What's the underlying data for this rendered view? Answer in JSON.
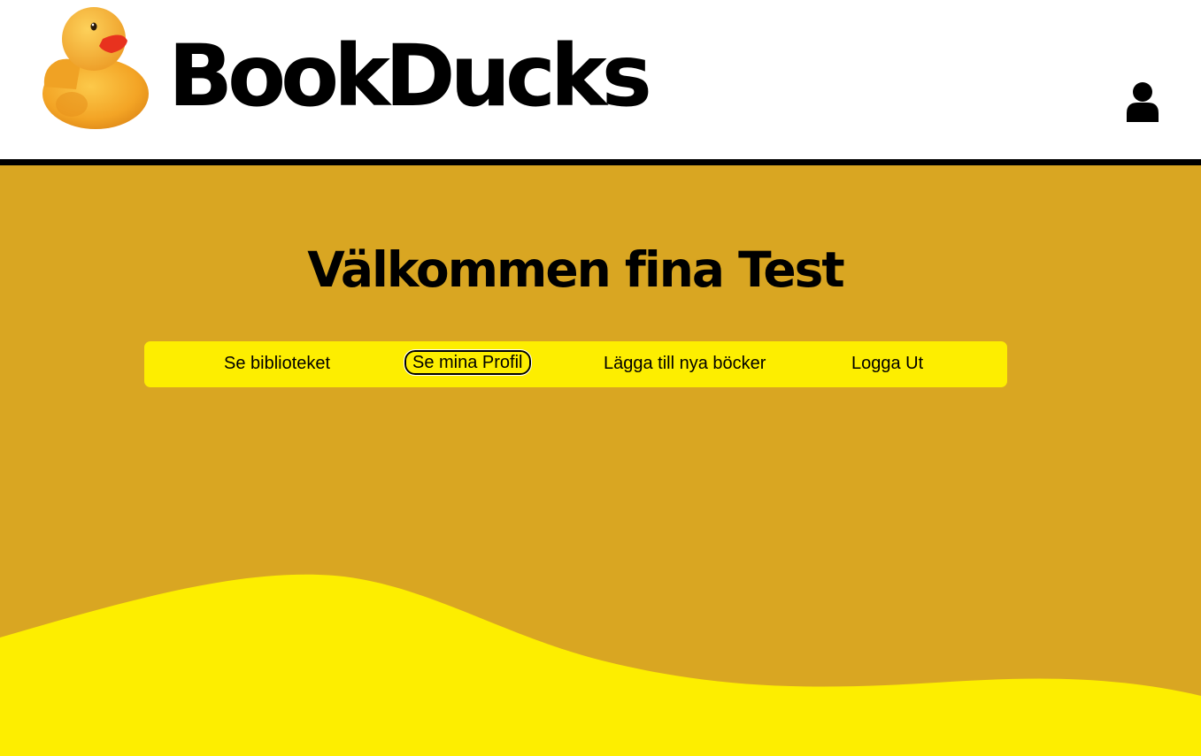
{
  "header": {
    "brand": "BookDucks",
    "logo_icon": "rubber-duck-icon",
    "user_icon": "user-icon"
  },
  "main": {
    "welcome": "Välkommen fina Test",
    "nav": [
      {
        "label": "Se biblioteket"
      },
      {
        "label": "Se mina Profil",
        "active": true
      },
      {
        "label": "Lägga till nya böcker"
      },
      {
        "label": "Logga Ut"
      }
    ]
  },
  "colors": {
    "background": "#d9a622",
    "accent_yellow": "#fdee00",
    "header_bg": "#ffffff",
    "border": "#000000"
  }
}
